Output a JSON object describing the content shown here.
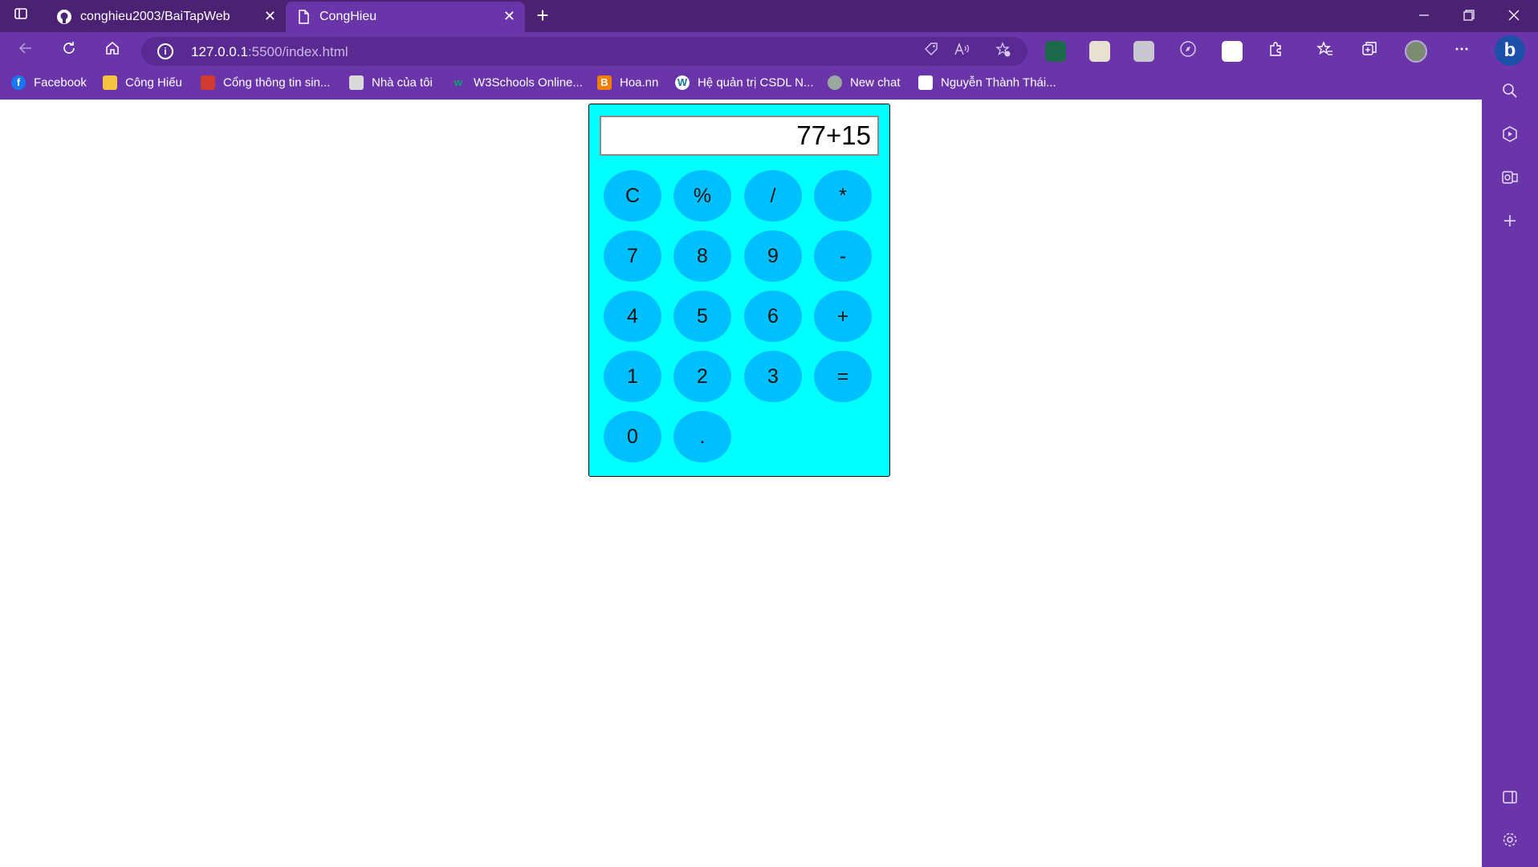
{
  "browser": {
    "tabs": [
      {
        "title": "conghieu2003/BaiTapWeb",
        "active": false
      },
      {
        "title": "CongHieu",
        "active": true
      }
    ],
    "tab_close_glyph": "✕",
    "new_tab_glyph": "+",
    "url_host": "127.0.0.1",
    "url_rest": ":5500/index.html",
    "bookmarks": [
      {
        "label": "Facebook",
        "icon": "facebook-icon"
      },
      {
        "label": "Công Hiếu",
        "icon": "folder-icon"
      },
      {
        "label": "Cổng thông tin sin...",
        "icon": "portal-icon"
      },
      {
        "label": "Nhà của tôi",
        "icon": "home-page-icon"
      },
      {
        "label": "W3Schools Online...",
        "icon": "w3schools-icon"
      },
      {
        "label": "Hoa.nn",
        "icon": "blogger-icon"
      },
      {
        "label": "Hệ quản trị CSDL N...",
        "icon": "wordpress-icon"
      },
      {
        "label": "New chat",
        "icon": "chatgpt-icon"
      },
      {
        "label": "Nguyễn Thành Thái...",
        "icon": "site-icon"
      }
    ],
    "theme": {
      "titlebar": "#4b2173",
      "toolbar": "#6a35a8"
    }
  },
  "calculator": {
    "display": "77+15",
    "keys": {
      "row1": [
        "C",
        "%",
        "/",
        "*"
      ],
      "row2": [
        "7",
        "8",
        "9",
        "-"
      ],
      "row3": [
        "4",
        "5",
        "6",
        "+"
      ],
      "row4": [
        "1",
        "2",
        "3",
        "="
      ],
      "row5": [
        "0",
        "."
      ]
    },
    "colors": {
      "body": "#00ffff",
      "key": "#00bfff"
    }
  }
}
